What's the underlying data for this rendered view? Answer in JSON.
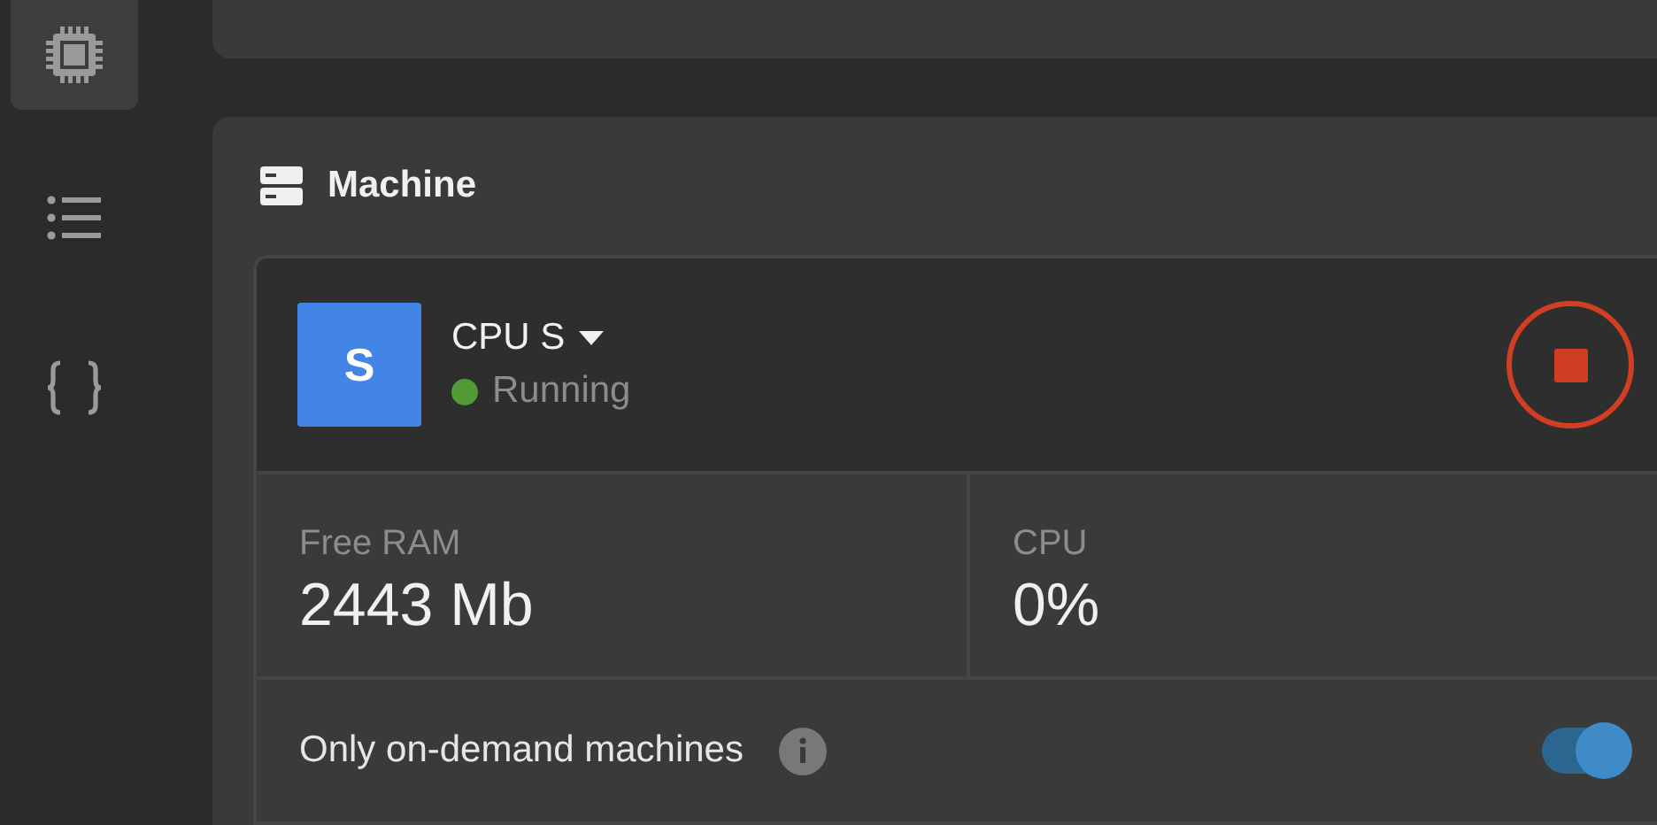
{
  "sidebar": {
    "items": [
      {
        "kind": "chip",
        "selected": true
      },
      {
        "kind": "list",
        "selected": false
      },
      {
        "kind": "braces",
        "selected": false
      }
    ]
  },
  "machine": {
    "title": "Machine",
    "avatar": "S",
    "name": "CPU S",
    "status": "Running",
    "running": true,
    "stats": [
      {
        "label": "Free RAM",
        "value": "2443 Mb"
      },
      {
        "label": "CPU",
        "value": "0%"
      }
    ],
    "option": {
      "label": "Only on-demand machines",
      "on": true
    }
  }
}
